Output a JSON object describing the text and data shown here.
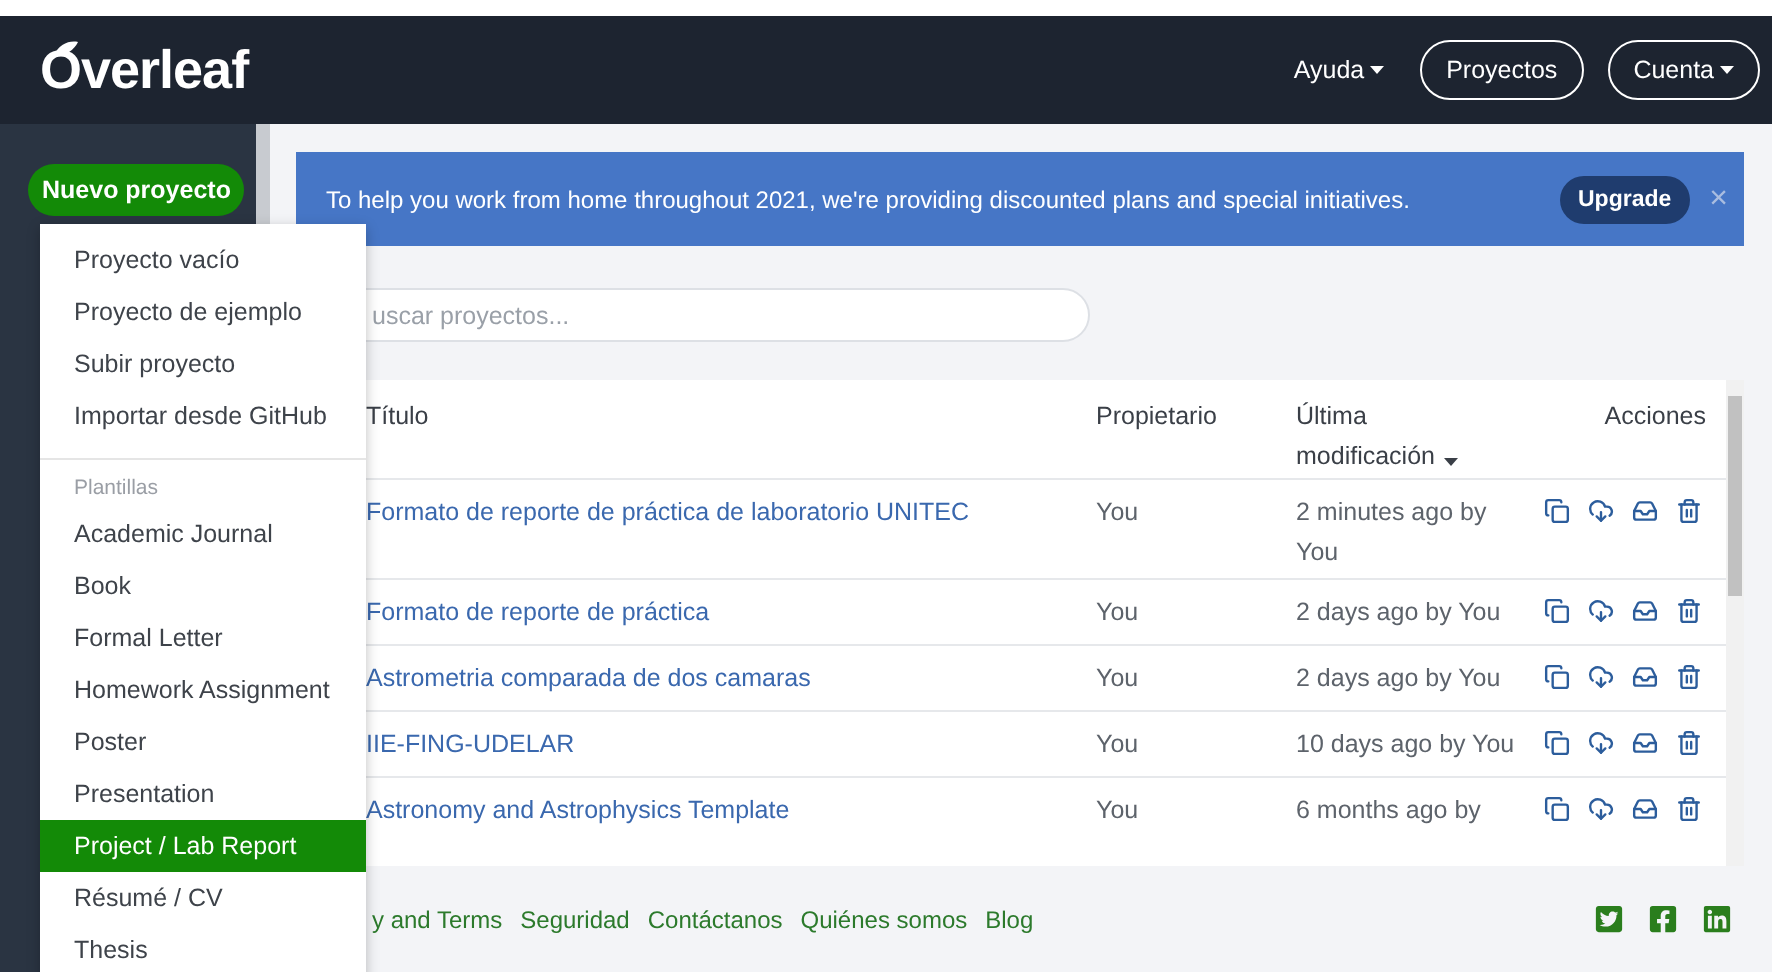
{
  "navbar": {
    "logo": "Overleaf",
    "links": [
      {
        "label": "Ayuda",
        "outlined": false,
        "caret": true
      },
      {
        "label": "Proyectos",
        "outlined": true,
        "caret": false
      },
      {
        "label": "Cuenta",
        "outlined": true,
        "caret": true
      }
    ]
  },
  "sidebar": {
    "new_project_button": "Nuevo proyecto"
  },
  "new_project_menu": {
    "items": [
      {
        "kind": "item",
        "label": "Proyecto vacío",
        "selected": false
      },
      {
        "kind": "item",
        "label": "Proyecto de ejemplo",
        "selected": false
      },
      {
        "kind": "item",
        "label": "Subir proyecto",
        "selected": false
      },
      {
        "kind": "item",
        "label": "Importar desde GitHub",
        "selected": false
      },
      {
        "kind": "header",
        "label": "Plantillas"
      },
      {
        "kind": "item",
        "label": "Academic Journal",
        "selected": false
      },
      {
        "kind": "item",
        "label": "Book",
        "selected": false
      },
      {
        "kind": "item",
        "label": "Formal Letter",
        "selected": false
      },
      {
        "kind": "item",
        "label": "Homework Assignment",
        "selected": false
      },
      {
        "kind": "item",
        "label": "Poster",
        "selected": false
      },
      {
        "kind": "item",
        "label": "Presentation",
        "selected": false
      },
      {
        "kind": "item",
        "label": "Project / Lab Report",
        "selected": true
      },
      {
        "kind": "item",
        "label": "Résumé / CV",
        "selected": false
      },
      {
        "kind": "item",
        "label": "Thesis",
        "selected": false
      }
    ]
  },
  "banner": {
    "text": "To help you work from home throughout 2021, we're providing discounted plans and special initiatives.",
    "button": "Upgrade",
    "close": "×"
  },
  "search": {
    "placeholder": "uscar proyectos..."
  },
  "table": {
    "columns": [
      {
        "label": "Título",
        "sorted": false
      },
      {
        "label": "Propietario",
        "sorted": false
      },
      {
        "label": "Última modificación",
        "sorted": true
      },
      {
        "label": "Acciones",
        "sorted": false
      }
    ],
    "rows": [
      {
        "title": "Formato de reporte de práctica de laboratorio UNITEC",
        "owner": "You",
        "modified": "2 minutes ago by You"
      },
      {
        "title": "Formato de reporte de práctica",
        "owner": "You",
        "modified": "2 days ago by You"
      },
      {
        "title": "Astrometria comparada de dos camaras",
        "owner": "You",
        "modified": "2 days ago by You"
      },
      {
        "title": "IIE-FING-UDELAR",
        "owner": "You",
        "modified": "10 days ago by You"
      },
      {
        "title": "Astronomy and Astrophysics Template",
        "owner": "You",
        "modified": "6 months ago by"
      }
    ]
  },
  "footer": {
    "links": [
      "y and Terms",
      "Seguridad",
      "Contáctanos",
      "Quiénes somos",
      "Blog"
    ]
  }
}
